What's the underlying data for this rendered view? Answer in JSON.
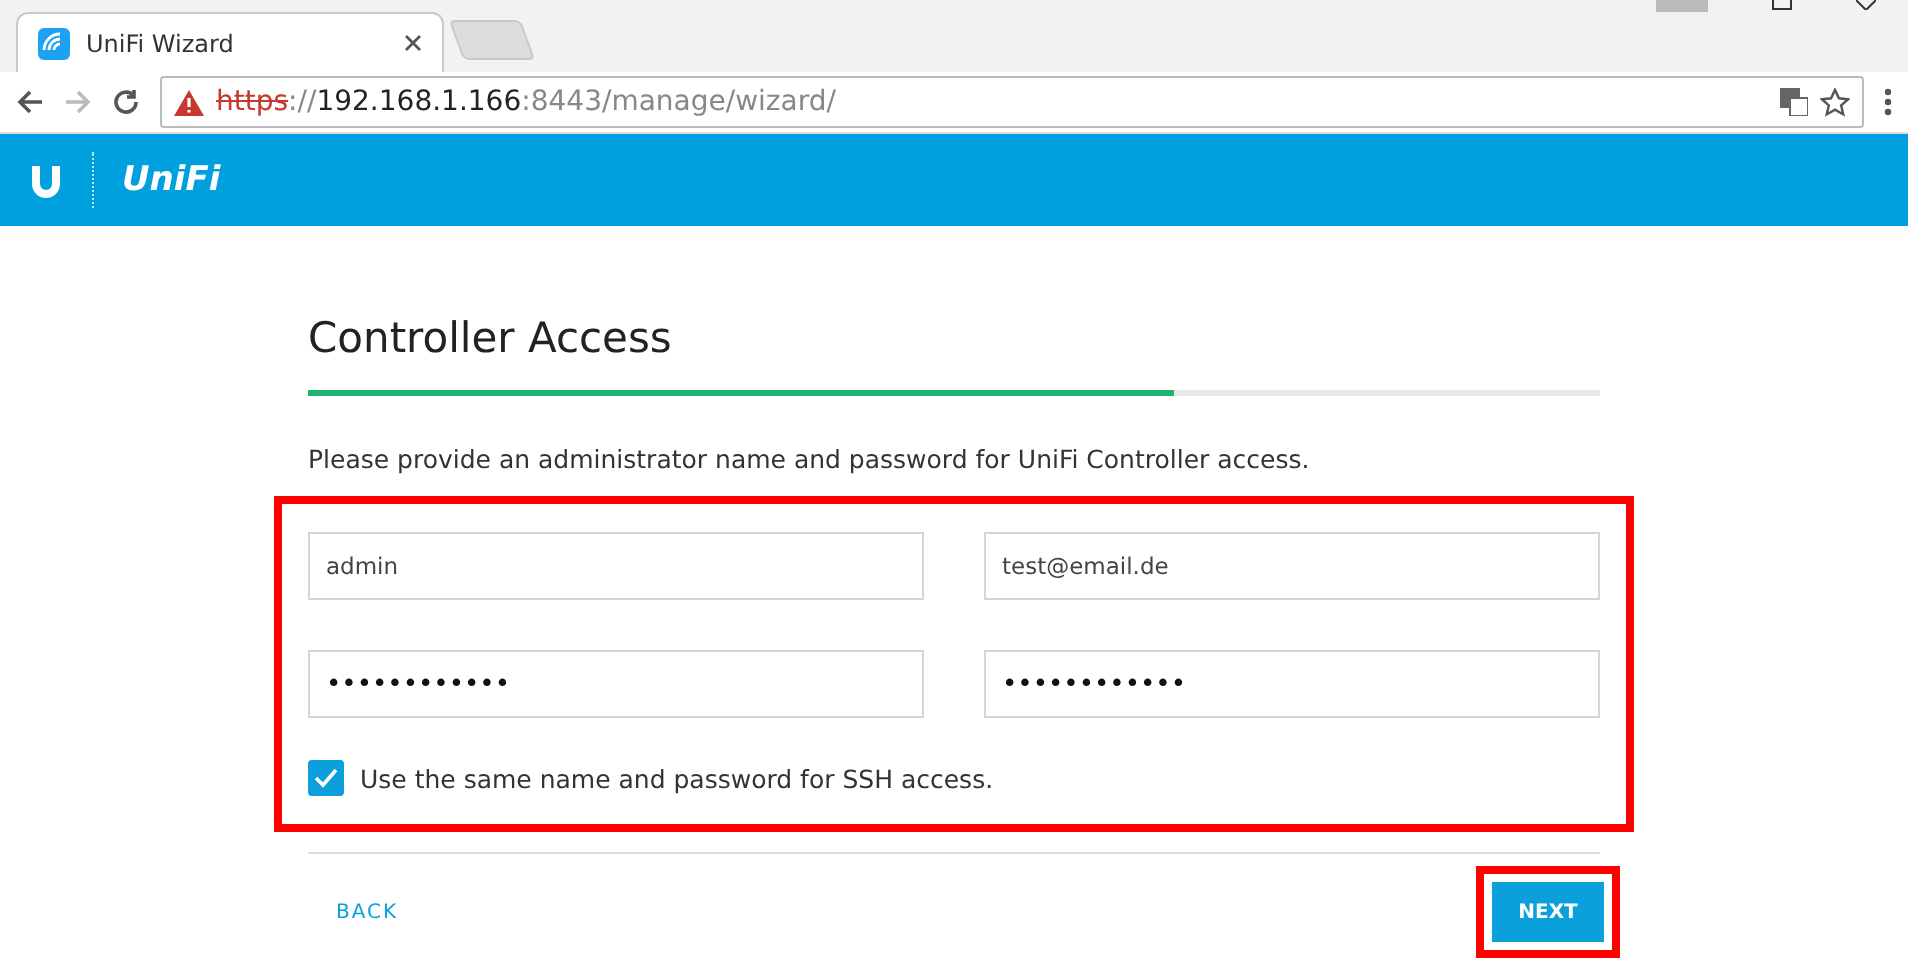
{
  "browser": {
    "tab_title": "UniFi Wizard",
    "url": {
      "scheme": "https",
      "separator": "://",
      "host": "192.168.1.166",
      "path": ":8443/manage/wizard/",
      "insecure": true
    }
  },
  "header": {
    "brand": "UniFi"
  },
  "wizard": {
    "title": "Controller Access",
    "progress": {
      "level": 0.67
    },
    "intro": "Please provide an administrator name and password for UniFi Controller access.",
    "fields": [
      {
        "value": "admin"
      },
      {
        "value": "test@email.de"
      },
      {
        "value": "••••••••••••"
      },
      {
        "value": "••••••••••••"
      }
    ],
    "ssh_checkbox": {
      "label": "Use the same name and password for SSH access.",
      "checked": true
    },
    "back": "BACK",
    "next": "NEXT"
  }
}
